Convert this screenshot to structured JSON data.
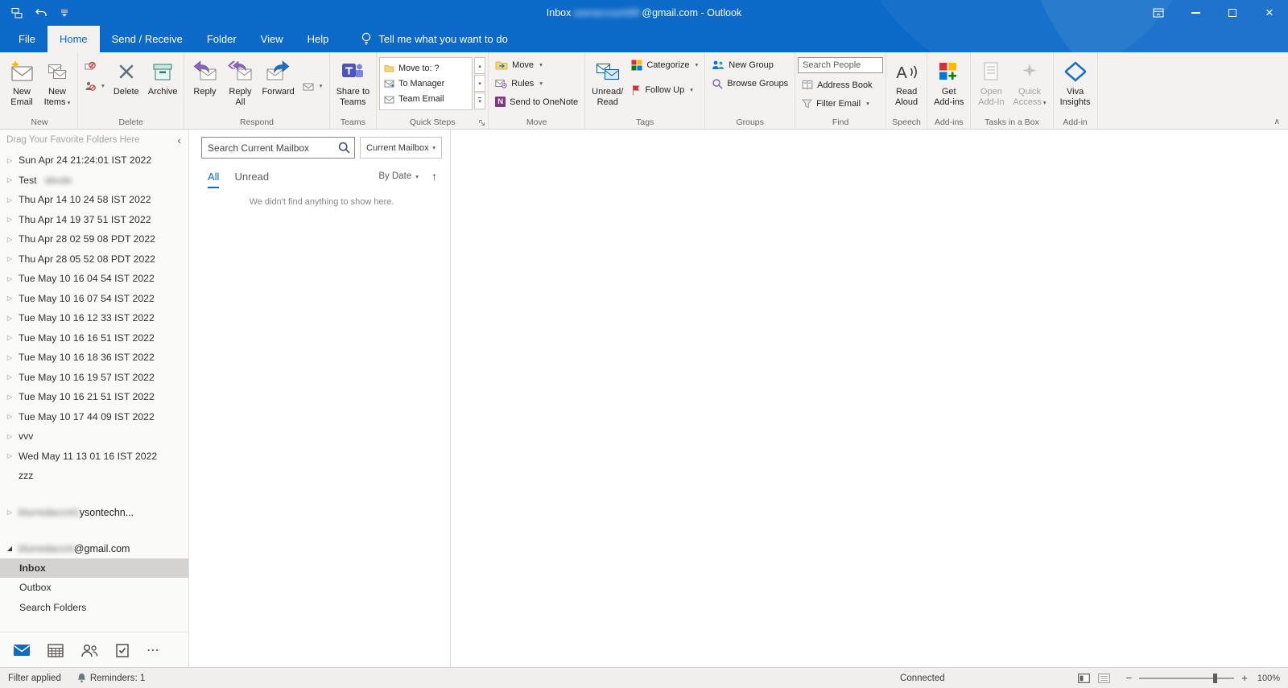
{
  "titlebar": {
    "title_prefix": "Inbox",
    "blurred_account": "useraccount99",
    "title_suffix": "@gmail.com  -  Outlook"
  },
  "tabs": {
    "file": "File",
    "home": "Home",
    "send_receive": "Send / Receive",
    "folder": "Folder",
    "view": "View",
    "help": "Help",
    "tellme": "Tell me what you want to do"
  },
  "ribbon": {
    "new_email_l1": "New",
    "new_email_l2": "Email",
    "new_items_l1": "New",
    "new_items_l2": "Items",
    "delete": "Delete",
    "archive": "Archive",
    "reply": "Reply",
    "reply_all_l1": "Reply",
    "reply_all_l2": "All",
    "forward": "Forward",
    "share_l1": "Share to",
    "share_l2": "Teams",
    "qs_move_to": "Move to: ?",
    "qs_to_manager": "To Manager",
    "qs_team_email": "Team Email",
    "move": "Move",
    "rules": "Rules",
    "onenote": "Send to OneNote",
    "unread_l1": "Unread/",
    "unread_l2": "Read",
    "categorize": "Categorize",
    "follow_up": "Follow Up",
    "new_group": "New Group",
    "browse_groups": "Browse Groups",
    "search_people": "Search People",
    "address_book": "Address Book",
    "filter_email": "Filter Email",
    "read_l1": "Read",
    "read_l2": "Aloud",
    "get_l1": "Get",
    "get_l2": "Add-ins",
    "open_l1": "Open",
    "open_l2": "Add-In",
    "qa_l1": "Quick",
    "qa_l2": "Access",
    "viva_l1": "Viva",
    "viva_l2": "Insights",
    "labels": {
      "new": "New",
      "delete": "Delete",
      "respond": "Respond",
      "teams": "Teams",
      "quick_steps": "Quick Steps",
      "move": "Move",
      "tags": "Tags",
      "groups": "Groups",
      "find": "Find",
      "speech": "Speech",
      "addins": "Add-ins",
      "tasks": "Tasks in a Box",
      "addin": "Add-in"
    }
  },
  "folder_pane": {
    "favorites_hint": "Drag Your Favorite Folders Here",
    "folders": [
      {
        "label": "Sun Apr 24 21:24:01 IST 2022"
      },
      {
        "label": "Test"
      },
      {
        "label": "Thu Apr 14 10 24 58 IST 2022"
      },
      {
        "label": "Thu Apr 14 19 37 51 IST 2022"
      },
      {
        "label": "Thu Apr 28 02 59 08 PDT 2022"
      },
      {
        "label": "Thu Apr 28 05 52 08 PDT 2022"
      },
      {
        "label": "Tue May 10 16 04 54 IST 2022"
      },
      {
        "label": "Tue May 10 16 07 54 IST 2022"
      },
      {
        "label": "Tue May 10 16 12 33 IST 2022"
      },
      {
        "label": "Tue May 10 16 16 51 IST 2022"
      },
      {
        "label": "Tue May 10 16 18 36 IST 2022"
      },
      {
        "label": "Tue May 10 16 19 57 IST 2022"
      },
      {
        "label": "Tue May 10 16 21 51 IST 2022"
      },
      {
        "label": "Tue May 10 17 44 09 IST 2022"
      },
      {
        "label": "vvv"
      },
      {
        "label": "Wed May 11 13 01 16 IST 2022"
      },
      {
        "label": "zzz"
      }
    ],
    "test_blur": "abcde",
    "account1_blur": "blurredaccnt1",
    "account1_visible": "ysontechn...",
    "account2_blur": "blurredaccnt",
    "account2_visible": "@gmail.com",
    "inbox": "Inbox",
    "outbox": "Outbox",
    "search_folders": "Search Folders"
  },
  "list": {
    "search_placeholder": "Search Current Mailbox",
    "mailbox_scope": "Current Mailbox",
    "tab_all": "All",
    "tab_unread": "Unread",
    "sort": "By Date",
    "empty": "We didn't find anything to show here."
  },
  "status": {
    "filter_applied": "Filter applied",
    "reminders": "Reminders: 1",
    "connected": "Connected",
    "zoom": "100%"
  }
}
